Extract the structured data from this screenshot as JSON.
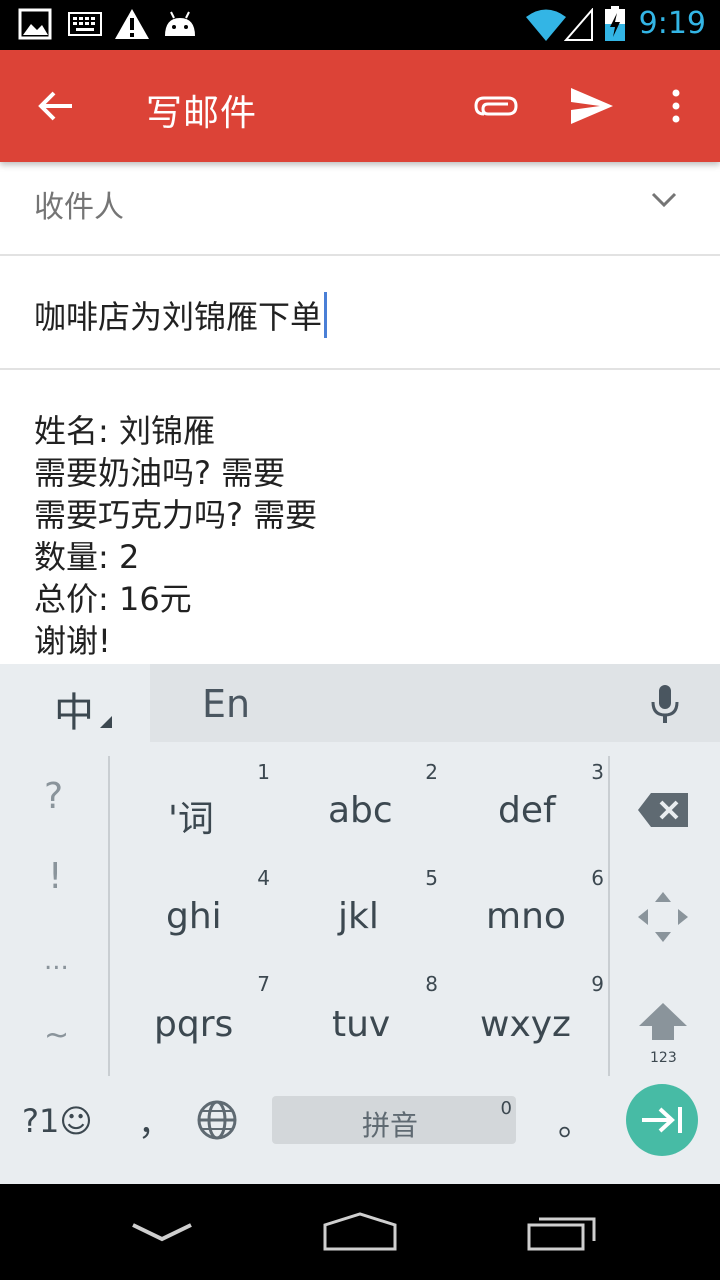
{
  "status_bar": {
    "time": "9:19"
  },
  "app_bar": {
    "title": "写邮件"
  },
  "compose": {
    "to_label": "收件人",
    "subject": "咖啡店为刘锦雁下单",
    "body_lines": [
      "姓名: 刘锦雁",
      "需要奶油吗? 需要",
      "需要巧克力吗? 需要",
      "数量: 2",
      "总价: 16元",
      "谢谢!"
    ]
  },
  "keyboard": {
    "mode_zh": "中",
    "mode_en": "En",
    "symbols": [
      "?",
      "!",
      "...",
      "~"
    ],
    "keys": [
      {
        "num": "1",
        "label": "'词"
      },
      {
        "num": "2",
        "label": "abc"
      },
      {
        "num": "3",
        "label": "def"
      },
      {
        "num": "4",
        "label": "ghi"
      },
      {
        "num": "5",
        "label": "jkl"
      },
      {
        "num": "6",
        "label": "mno"
      },
      {
        "num": "7",
        "label": "pqrs"
      },
      {
        "num": "8",
        "label": "tuv"
      },
      {
        "num": "9",
        "label": "wxyz"
      }
    ],
    "shift_label": "123",
    "sym_key": "?1☺",
    "comma": "，",
    "space_label": "拼音",
    "space_num": "0",
    "period": "。"
  }
}
